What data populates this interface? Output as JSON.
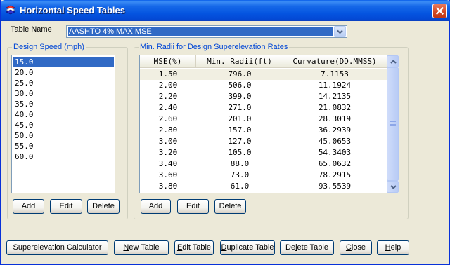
{
  "window": {
    "title": "Horizontal Speed Tables",
    "icon": "app-icon",
    "close_icon": "close-icon"
  },
  "table_name": {
    "label": "Table Name",
    "value": "AASHTO 4% MAX MSE",
    "dropdown_icon": "chevron-down-icon"
  },
  "design_speed": {
    "title": "Design Speed (mph)",
    "items": [
      "15.0",
      "20.0",
      "25.0",
      "30.0",
      "35.0",
      "40.0",
      "45.0",
      "50.0",
      "55.0",
      "60.0"
    ],
    "selected_index": 0,
    "buttons": {
      "add": "Add",
      "edit": "Edit",
      "delete": "Delete"
    }
  },
  "radii": {
    "title": "Min. Radii for Design Superelevation Rates",
    "columns": [
      "MSE(%)",
      "Min. Radii(ft)",
      "Curvature(DD.MMSS)"
    ],
    "rows": [
      [
        "1.50",
        "796.0",
        "7.1153"
      ],
      [
        "2.00",
        "506.0",
        "11.1924"
      ],
      [
        "2.20",
        "399.0",
        "14.2135"
      ],
      [
        "2.40",
        "271.0",
        "21.0832"
      ],
      [
        "2.60",
        "201.0",
        "28.3019"
      ],
      [
        "2.80",
        "157.0",
        "36.2939"
      ],
      [
        "3.00",
        "127.0",
        "45.0653"
      ],
      [
        "3.20",
        "105.0",
        "54.3403"
      ],
      [
        "3.40",
        "88.0",
        "65.0632"
      ],
      [
        "3.60",
        "73.0",
        "78.2915"
      ],
      [
        "3.80",
        "61.0",
        "93.5539"
      ]
    ],
    "selected_index": 0,
    "buttons": {
      "add": "Add",
      "edit": "Edit",
      "delete": "Delete"
    }
  },
  "footer": {
    "superelevation_calculator": "Superelevation Calculator",
    "new_table_u": "N",
    "new_table_rest": "ew Table",
    "edit_table_u": "E",
    "edit_table_rest": "dit Table",
    "duplicate_table_u": "D",
    "duplicate_table_rest": "uplicate Table",
    "delete_table_pre": "De",
    "delete_table_u": "l",
    "delete_table_rest": "ete Table",
    "close_u": "C",
    "close_rest": "lose",
    "help_u": "H",
    "help_rest": "elp"
  },
  "colors": {
    "selection": "#316ac5",
    "group_title": "#0046d5",
    "titlebar": "#0454e0",
    "dialog_bg": "#ece9d8"
  }
}
